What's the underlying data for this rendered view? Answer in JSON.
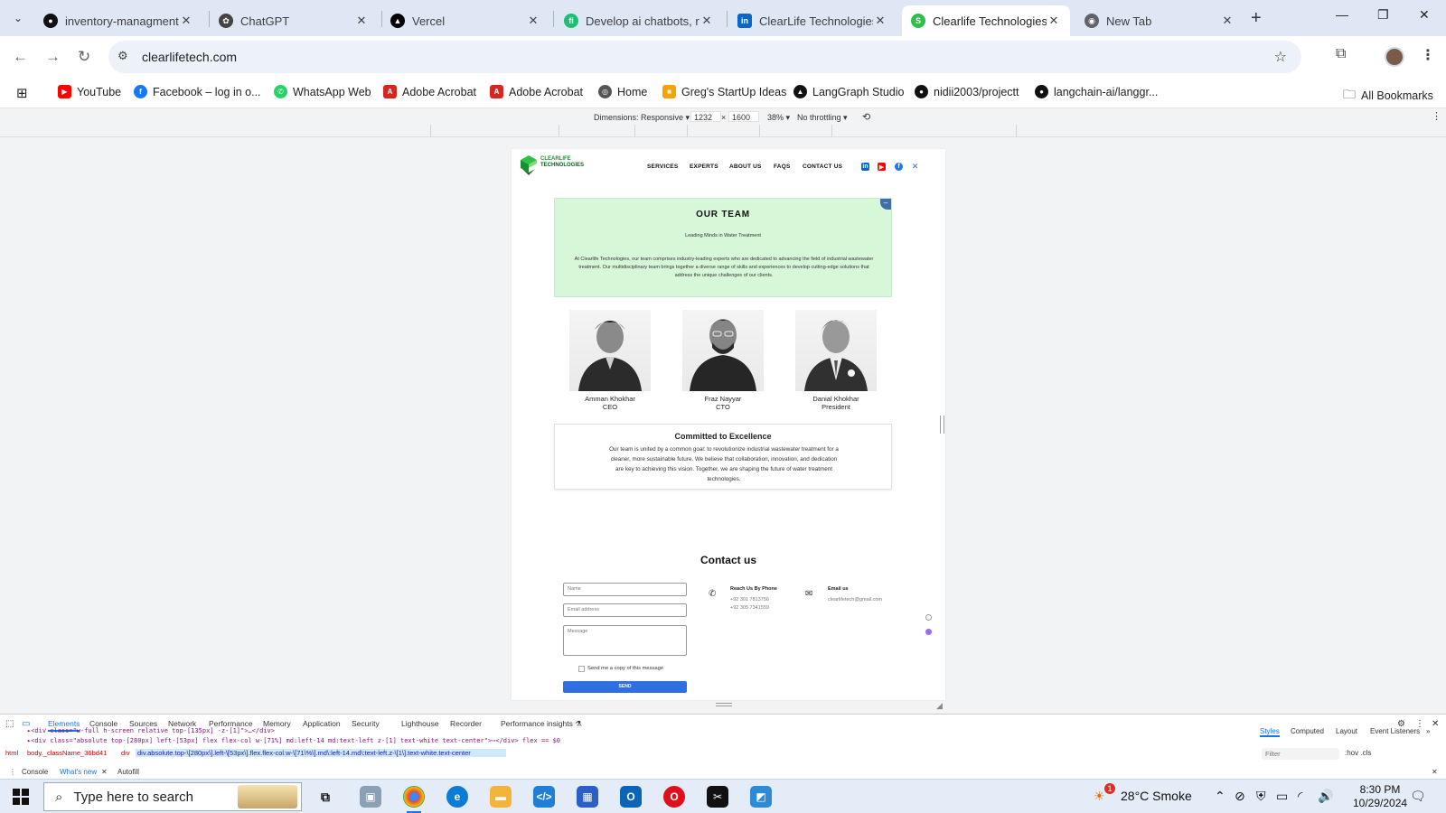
{
  "browser": {
    "tabs": [
      {
        "title": "inventory-managment",
        "favicon": "github-icon",
        "color": "#111111"
      },
      {
        "title": "ChatGPT",
        "favicon": "chatgpt-icon",
        "color": "#444444"
      },
      {
        "title": "Vercel",
        "favicon": "vercel-icon",
        "color": "#000000"
      },
      {
        "title": "Develop ai chatbots, ra",
        "favicon": "fiverr-icon",
        "color": "#1dbf73"
      },
      {
        "title": "ClearLife Technologies",
        "favicon": "linkedin-icon",
        "color": "#0a66c2"
      },
      {
        "title": "Clearlife Technologies",
        "favicon": "clearlife-icon",
        "color": "#2fbf4a",
        "active": true
      },
      {
        "title": "New Tab",
        "favicon": "chrome-icon",
        "color": "#5f6368"
      }
    ],
    "url": "clearlifetech.com",
    "bookmarks": [
      {
        "label": "YouTube",
        "icon": "youtube-icon",
        "color": "#ff0000"
      },
      {
        "label": "Facebook – log in o...",
        "icon": "facebook-icon",
        "color": "#1877f2"
      },
      {
        "label": "WhatsApp Web",
        "icon": "whatsapp-icon",
        "color": "#25d366"
      },
      {
        "label": "Adobe Acrobat",
        "icon": "acrobat-icon",
        "color": "#d4271f"
      },
      {
        "label": "Adobe Acrobat",
        "icon": "acrobat-icon",
        "color": "#d4271f"
      },
      {
        "label": "Home",
        "icon": "globe-icon",
        "color": "#555555"
      },
      {
        "label": "Greg's StartUp Ideas",
        "icon": "ideas-icon",
        "color": "#f4a300"
      },
      {
        "label": "LangGraph Studio",
        "icon": "langgraph-icon",
        "color": "#111111"
      },
      {
        "label": "nidii2003/projectt",
        "icon": "github-icon",
        "color": "#111111"
      },
      {
        "label": "langchain-ai/langgr...",
        "icon": "github-icon",
        "color": "#111111"
      }
    ],
    "all_bookmarks": "All Bookmarks"
  },
  "device_toolbar": {
    "dimensions_label": "Dimensions: Responsive ▾",
    "width": "1232",
    "times": "×",
    "height": "1600",
    "zoom": "38% ▾",
    "throttling": "No throttling ▾"
  },
  "site": {
    "logo_line1": "CLEARLIFE",
    "logo_line2": "TECHNOLOGIES",
    "nav": [
      "SERVICES",
      "EXPERTS",
      "ABOUT US",
      "FAQS",
      "CONTACT US"
    ],
    "team": {
      "title": "OUR TEAM",
      "subtitle": "Leading Minds in Water Treatment",
      "description": "At Clearlife Technologies, our team comprises industry-leading experts who are dedicated to advancing the field of industrial wastewater treatment. Our multidisciplinary team brings together a diverse range of skills and experiences to develop cutting-edge solutions that address the unique challenges of our clients."
    },
    "members": [
      {
        "name": "Amman Khokhar",
        "role": "CEO"
      },
      {
        "name": "Fraz Nayyar",
        "role": "CTO"
      },
      {
        "name": "Danial Khokhar",
        "role": "President"
      }
    ],
    "commitment": {
      "title": "Committed to Excellence",
      "body": "Our team is united by a common goal: to revolutionize industrial wastewater treatment for a cleaner, more sustainable future. We believe that collaboration, innovation, and dedication are key to achieving this vision. Together, we are shaping the future of water treatment technologies."
    },
    "contact": {
      "title": "Contact us",
      "name_placeholder": "Name",
      "email_placeholder": "Email address",
      "message_placeholder": "Message",
      "copy_label": "Send me a copy of this message",
      "send_label": "SEND",
      "phone_heading": "Reach Us By Phone",
      "phone_1": "+92 301 7813756",
      "phone_2": "+92 305 7341559",
      "email_heading": "Email us",
      "email_value": "clearlifetech@gmail.com"
    }
  },
  "devtools": {
    "tabs": [
      "Elements",
      "Console",
      "Sources",
      "Network",
      "Performance",
      "Memory",
      "Application",
      "Security",
      "Lighthouse",
      "Recorder",
      "Performance insights ⚗"
    ],
    "code_line_1": "▸<div class=\"w-full h-screen relative top-[135px] -z-[1]\">…</div>",
    "code_line_2": "▸<div class=\"absolute top-[280px] left-[53px] flex flex-col w-[71%] md:left-14 md:text-left z-[1]  text-white text-center\">⋯</div> flex == $0",
    "breadcrumbs": [
      "html",
      "body._className_36bd41",
      "div"
    ],
    "selected_crumb": "div.absolute.top-\\[280px\\].left-\\[53px\\].flex.flex-col.w-\\[71\\%\\].md\\:left-14.md\\:text-left.z-\\[1\\].text-white.text-center",
    "side_tabs": [
      "Styles",
      "Computed",
      "Layout",
      "Event Listeners",
      "»"
    ],
    "filter_placeholder": "Filter",
    "filter_tools": ":hov .cls",
    "drawer": [
      "Console",
      "What's new",
      "Autofill"
    ]
  },
  "taskbar": {
    "search_placeholder": "Type here to search",
    "weather": "28°C  Smoke",
    "notification_count": "1",
    "time": "8:30 PM",
    "date": "10/29/2024"
  }
}
